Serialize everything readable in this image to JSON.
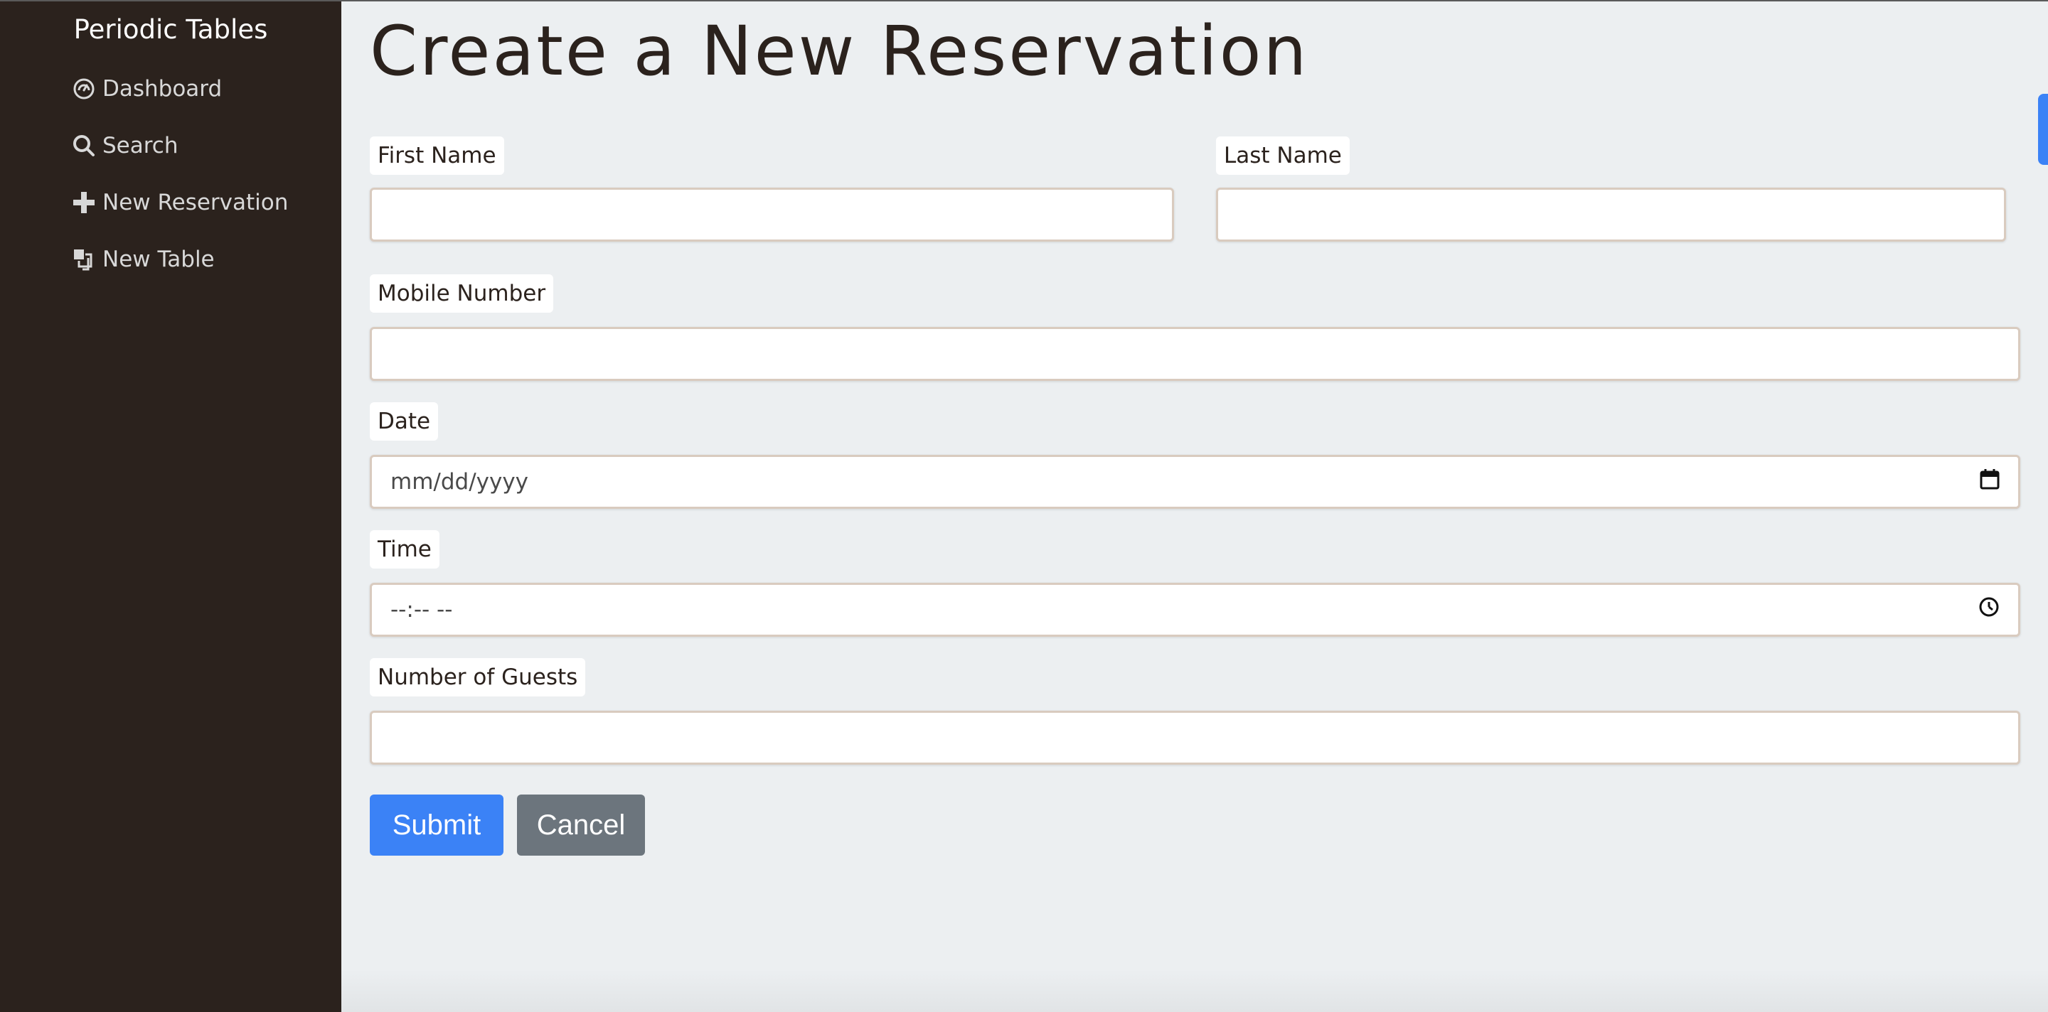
{
  "sidebar": {
    "brand": "Periodic Tables",
    "items": [
      {
        "label": "Dashboard",
        "icon": "dashboard-gauge-icon"
      },
      {
        "label": "Search",
        "icon": "search-icon"
      },
      {
        "label": "New Reservation",
        "icon": "plus-icon"
      },
      {
        "label": "New Table",
        "icon": "layers-icon"
      }
    ]
  },
  "main": {
    "title": "Create a New Reservation",
    "form": {
      "first_name_label": "First Name",
      "first_name_value": "",
      "last_name_label": "Last Name",
      "last_name_value": "",
      "mobile_label": "Mobile Number",
      "mobile_value": "",
      "date_label": "Date",
      "date_placeholder": "mm/dd/yyyy",
      "time_label": "Time",
      "time_placeholder": "--:-- --",
      "guests_label": "Number of Guests",
      "guests_value": ""
    },
    "buttons": {
      "submit": "Submit",
      "cancel": "Cancel"
    }
  },
  "colors": {
    "sidebar_bg": "#2b221d",
    "main_bg": "#eceff1",
    "primary": "#3b82f6",
    "secondary": "#6c757d",
    "input_border": "#d9cbbf"
  }
}
